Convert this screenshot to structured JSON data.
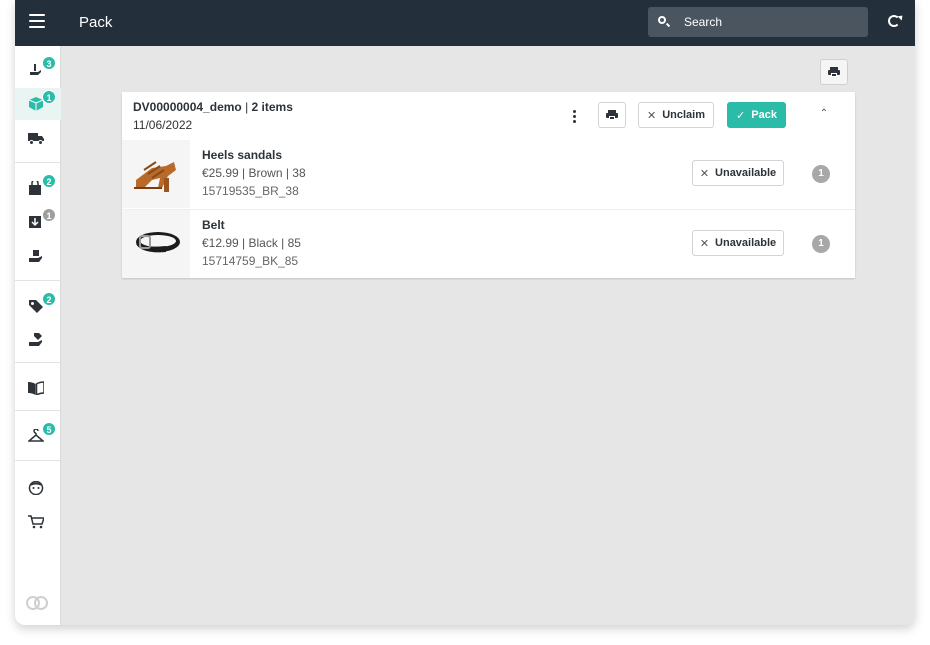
{
  "header": {
    "title": "Pack",
    "search_placeholder": "Search"
  },
  "sidebar": {
    "items": [
      {
        "icon": "hand-pick-icon",
        "badge": "3",
        "badge_color": "#2bbca9",
        "active": false
      },
      {
        "icon": "package-icon",
        "badge": "1",
        "badge_color": "#2bbca9",
        "active": true
      },
      {
        "icon": "truck-icon",
        "badge": "",
        "active": false
      },
      {
        "icon": "bag-lock-icon",
        "badge": "2",
        "badge_color": "#2bbca9",
        "active": false
      },
      {
        "icon": "inbox-download-icon",
        "badge": "1",
        "badge_color": "#9e9e9e",
        "active": false
      },
      {
        "icon": "hand-box-icon",
        "badge": "",
        "active": false
      },
      {
        "icon": "tag-percent-icon",
        "badge": "2",
        "badge_color": "#2bbca9",
        "active": false
      },
      {
        "icon": "hand-tag-icon",
        "badge": "",
        "active": false
      },
      {
        "icon": "book-open-icon",
        "badge": "",
        "active": false
      },
      {
        "icon": "hanger-icon",
        "badge": "5",
        "badge_color": "#2bbca9",
        "active": false
      },
      {
        "icon": "face-icon",
        "badge": "",
        "active": false
      },
      {
        "icon": "cart-icon",
        "badge": "",
        "active": false
      }
    ]
  },
  "order": {
    "id": "DV00000004_demo",
    "separator": " | ",
    "items_count": "2 items",
    "date": "11/06/2022",
    "unclaim_label": "Unclaim",
    "pack_label": "Pack",
    "items": [
      {
        "name": "Heels sandals",
        "meta": "€25.99 | Brown | 38",
        "sku": "15719535_BR_38",
        "unavailable_label": "Unavailable",
        "qty": "1"
      },
      {
        "name": "Belt",
        "meta": "€12.99 | Black | 85",
        "sku": "15714759_BK_85",
        "unavailable_label": "Unavailable",
        "qty": "1"
      }
    ]
  },
  "colors": {
    "topbar": "#23303b",
    "accent": "#2bbca9",
    "background": "#e6e6e6"
  }
}
